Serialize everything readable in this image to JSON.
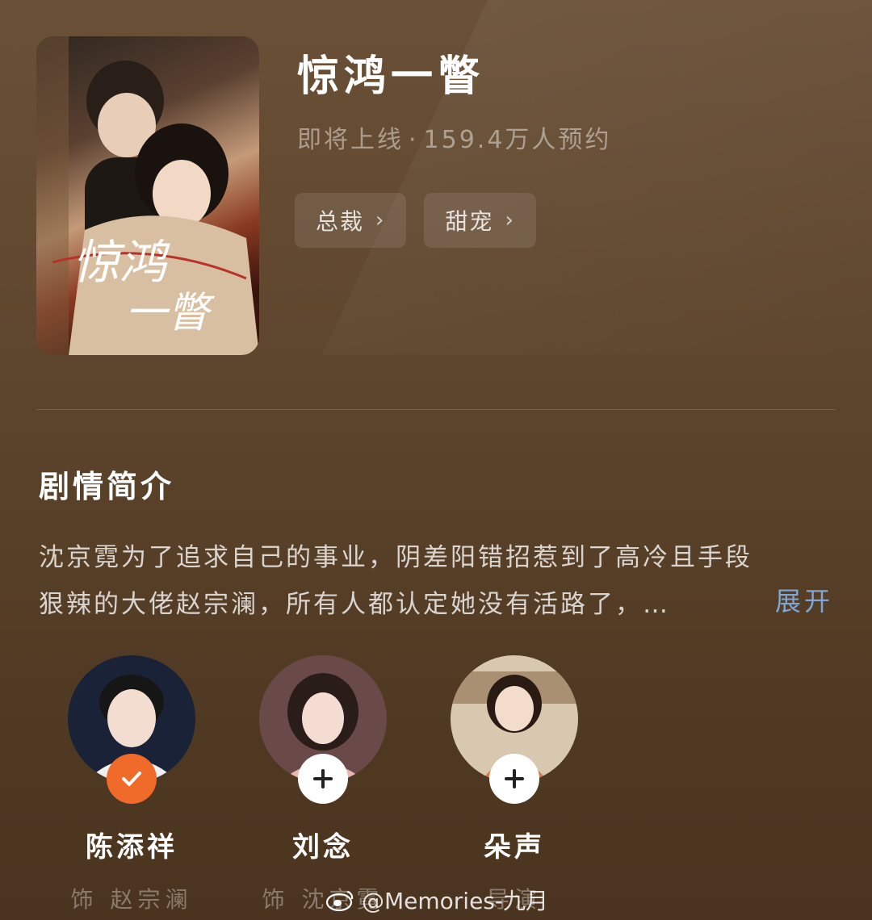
{
  "drama": {
    "title": "惊鸿一瞥",
    "status": "即将上线",
    "reservations": "159.4万人预约",
    "separator": "·",
    "tags": [
      {
        "label": "总裁"
      },
      {
        "label": "甜宠"
      }
    ]
  },
  "synopsis": {
    "heading": "剧情简介",
    "line1": "沈京霓为了追求自己的事业，阴差阳错招惹到了高冷且手段",
    "line2": "狠辣的大佬赵宗澜，所有人都认定她没有活路了，…",
    "expand_label": "展开"
  },
  "cast": [
    {
      "name": "陈添祥",
      "role": "饰 赵宗澜",
      "followed": true
    },
    {
      "name": "刘念",
      "role": "饰 沈京霓",
      "followed": false
    },
    {
      "name": "朵声",
      "role": "导演",
      "followed": false
    }
  ],
  "watermark": "@Memories-九月",
  "colors": {
    "accent_orange": "#f06a2a",
    "link_blue": "#7fa6d4",
    "background": "#5e452d"
  }
}
